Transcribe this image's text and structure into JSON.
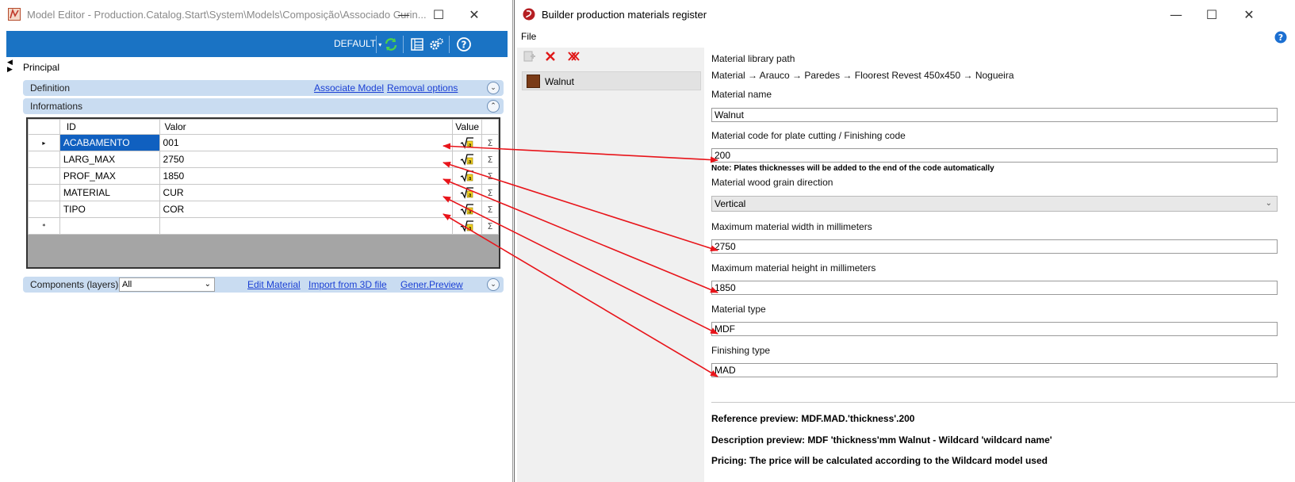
{
  "left_window": {
    "title": "Model Editor - Production.Catalog.Start\\System\\Models\\Composição\\Associado Curin...",
    "toolbar": {
      "profile_label": "DEFAULT",
      "icons": [
        "refresh-icon",
        "list-icon",
        "settings-icon",
        "help-icon"
      ]
    },
    "principal_label": "Principal",
    "definition": {
      "label": "Definition",
      "associate_model": "Associate Model",
      "removal_options": "Removal options"
    },
    "informations": {
      "label": "Informations",
      "columns": {
        "id": "ID",
        "valor": "Valor",
        "value": "Value"
      },
      "rows": [
        {
          "id": "ACABAMENTO",
          "valor": "001"
        },
        {
          "id": "LARG_MAX",
          "valor": "2750"
        },
        {
          "id": "PROF_MAX",
          "valor": "1850"
        },
        {
          "id": "MATERIAL",
          "valor": "CUR"
        },
        {
          "id": "TIPO",
          "valor": "COR"
        }
      ],
      "new_row_marker": "*",
      "current_row_marker": "▸"
    },
    "components": {
      "label": "Components (layers)",
      "selected": "All",
      "edit_material": "Edit Material",
      "import_3d": "Import from 3D file",
      "gener_preview": "Gener.Preview"
    }
  },
  "right_window": {
    "title": "Builder production materials register",
    "menu": {
      "file": "File"
    },
    "materials": [
      {
        "name": "Walnut",
        "swatch_color": "#7a3b17"
      }
    ],
    "form": {
      "library_path_label": "Material library path",
      "library_path_value": "Material → Arauco → Paredes → Floorest Revest 450x450 → Nogueira",
      "name_label": "Material name",
      "name_value": "Walnut",
      "code_label": "Material code for plate cutting / Finishing code",
      "code_value": "200",
      "code_note": "Note: Plates thicknesses will be added to the end of the code automatically",
      "grain_label": "Material wood grain direction",
      "grain_value": "Vertical",
      "width_label": "Maximum material width in millimeters",
      "width_value": "2750",
      "height_label": "Maximum material height in millimeters",
      "height_value": "1850",
      "type_label": "Material type",
      "type_value": "MDF",
      "finishing_label": "Finishing type",
      "finishing_value": "MAD"
    },
    "previews": {
      "reference": "Reference preview: MDF.MAD.'thickness'.200",
      "description": "Description preview: MDF 'thickness'mm Walnut - Wildcard 'wildcard name'",
      "pricing": "Pricing: The price will be calculated according to the Wildcard model used"
    }
  },
  "colors": {
    "toolbar_blue": "#1a73c4",
    "section_bar": "#c9dcf1",
    "selected_cell": "#1060c0",
    "link": "#1a3fd4",
    "annotation_arrow": "#e8141a"
  }
}
